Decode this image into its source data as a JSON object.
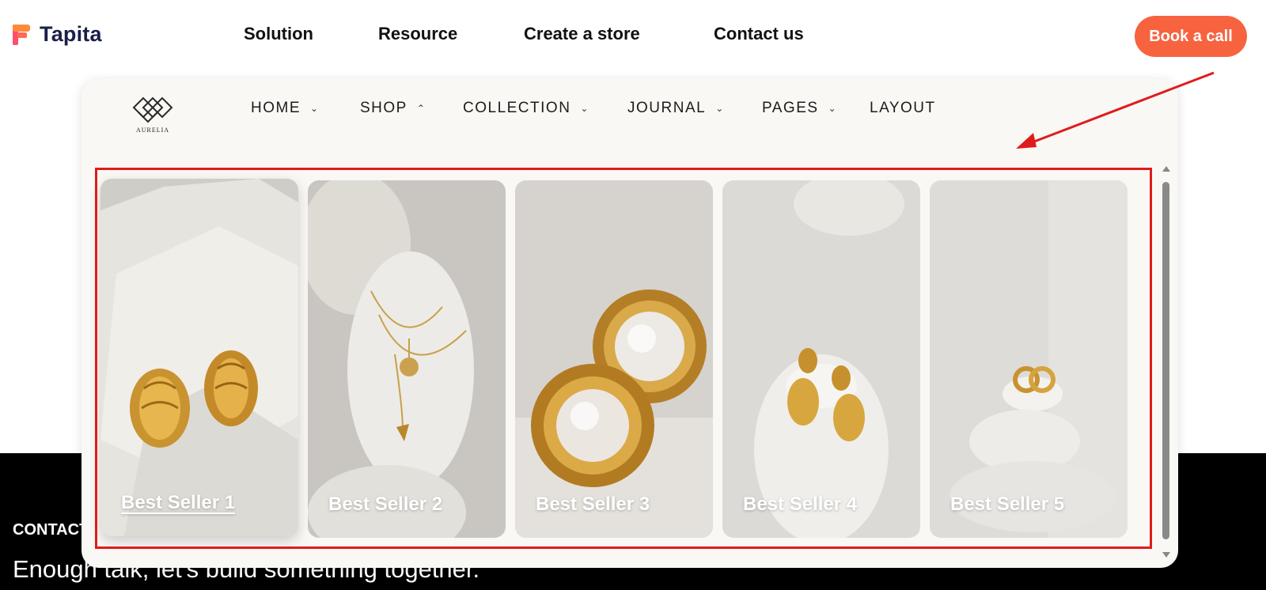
{
  "colors": {
    "accent": "#f7633f",
    "brand_text": "#1b1f4a",
    "annotation": "#e01b1b"
  },
  "header": {
    "brand": "Tapita",
    "nav": [
      "Solution",
      "Resource",
      "Create a store",
      "Contact us"
    ],
    "cta": "Book a call"
  },
  "store": {
    "logo_text": "AURELIA",
    "nav": [
      {
        "label": "HOME",
        "icon": "chevron-down-icon"
      },
      {
        "label": "SHOP",
        "icon": "chevron-up-icon"
      },
      {
        "label": "COLLECTION",
        "icon": "chevron-down-icon"
      },
      {
        "label": "JOURNAL",
        "icon": "chevron-down-icon"
      },
      {
        "label": "PAGES",
        "icon": "chevron-down-icon"
      },
      {
        "label": "LAYOUT",
        "icon": ""
      }
    ],
    "cards": [
      {
        "label": "Best Seller 1"
      },
      {
        "label": "Best Seller 2"
      },
      {
        "label": "Best Seller 3"
      },
      {
        "label": "Best Seller 4"
      },
      {
        "label": "Best Seller 5"
      }
    ]
  },
  "footer": {
    "contact": "CONTACT",
    "tagline": "Enough talk, let's build something together."
  }
}
